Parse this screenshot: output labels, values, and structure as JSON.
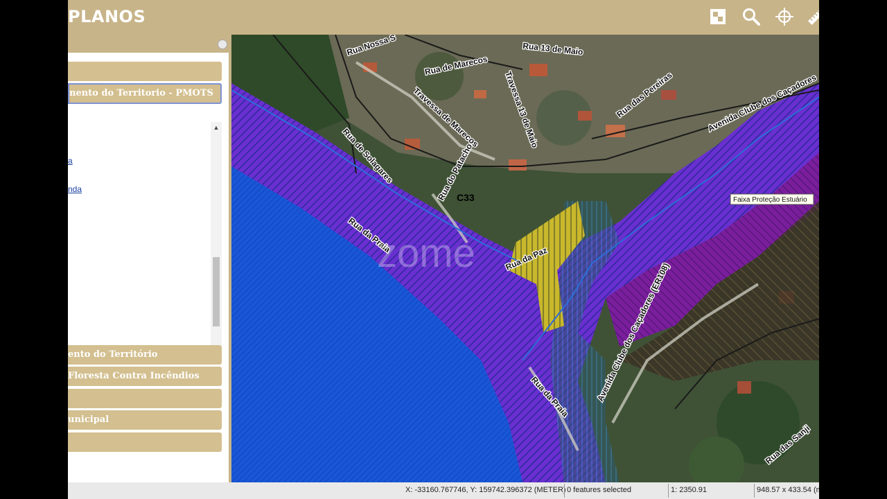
{
  "header": {
    "title": "PLANOS",
    "tools": [
      "layers-icon",
      "search-icon",
      "locate-icon",
      "measure-icon"
    ]
  },
  "panel": {
    "sections": [
      {
        "label": ""
      },
      {
        "label": "nento do Territorio - PMOTS"
      },
      {
        "label": "ento do Território"
      },
      {
        "label": "Floresta Contra Incêndios"
      },
      {
        "label": ""
      },
      {
        "label": "unicipal"
      },
      {
        "label": ""
      }
    ],
    "links": [
      "a",
      "nda"
    ]
  },
  "map": {
    "tooltip": "Faixa Proteção Estuário",
    "parcel_label": "C33",
    "watermark": "zome",
    "streets": {
      "nossa": "Rua Nossa S",
      "marecos": "Rua de Marecos",
      "treze_maio": "Rua 13 de Maio",
      "travessa_marecos": "Travessa de Marecos",
      "travessa_13": "Travessa 13 de Maio",
      "pereiras": "Rua das Pereiras",
      "avenida_cacadores": "Avenida Clube dos Caçadores",
      "solagares": "Rua de Solagares",
      "patacho": "Rua do Patacho",
      "praia1": "Rua da Praia",
      "paz": "Rua da Paz",
      "praia2": "Rua da Praia",
      "er108": "Avenida Clube dos Caçadores (ER108)",
      "sanjin": "Rua das Sanji"
    }
  },
  "status": {
    "coords": "X: -33160.767746, Y: 159742.396372 (METER)",
    "selected": "0 features selected",
    "scale": "1: 2350.91",
    "extent": "948.57 x 433.54 (m"
  }
}
